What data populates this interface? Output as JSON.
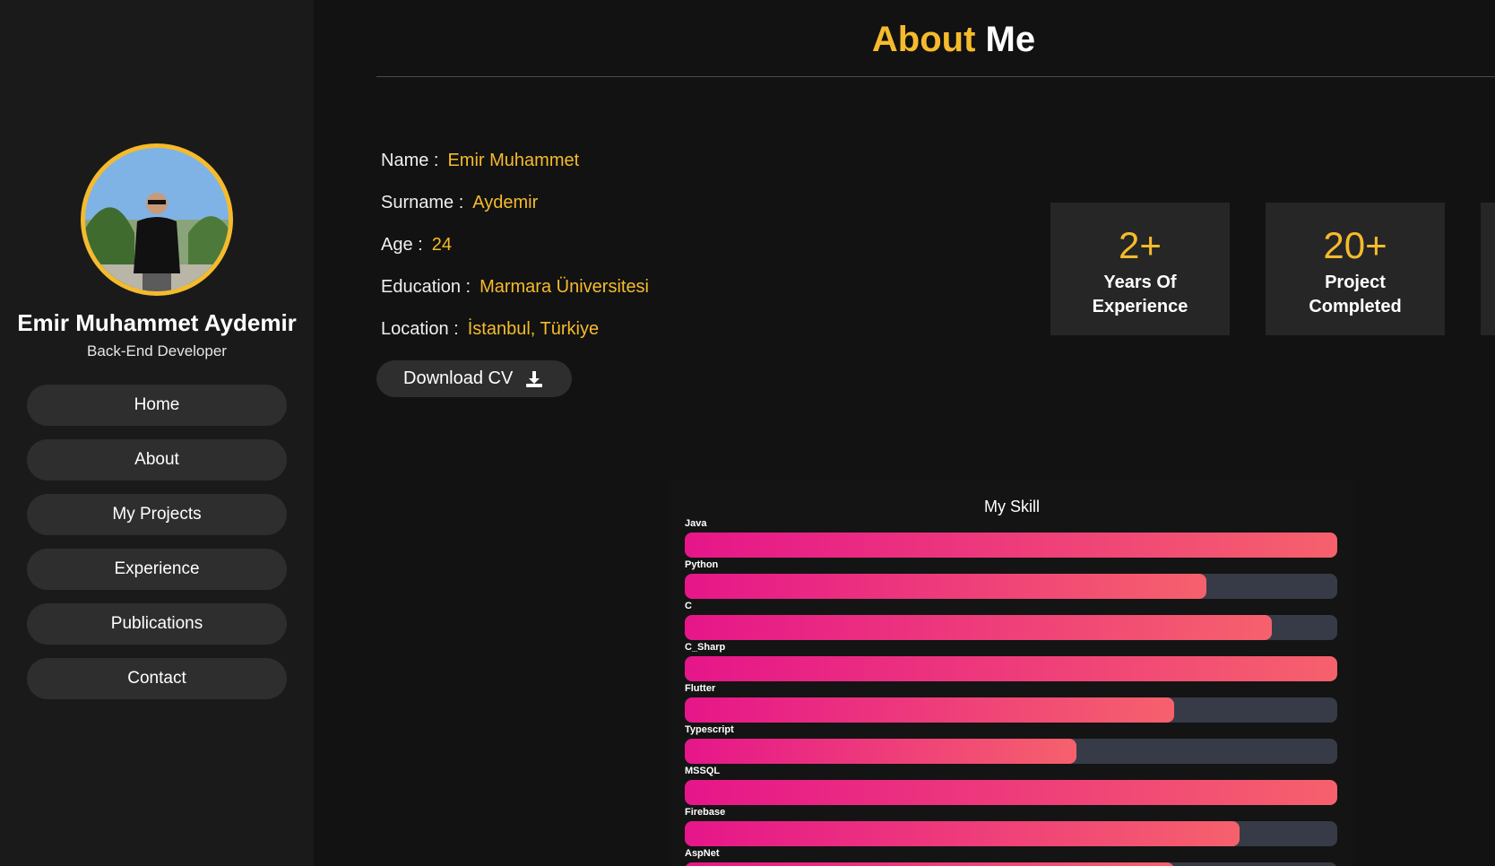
{
  "profile": {
    "name": "Emir Muhammet Aydemir",
    "role": "Back-End Developer"
  },
  "nav": [
    {
      "label": "Home"
    },
    {
      "label": "About"
    },
    {
      "label": "My Projects"
    },
    {
      "label": "Experience"
    },
    {
      "label": "Publications"
    },
    {
      "label": "Contact"
    }
  ],
  "page": {
    "title_accent": "About",
    "title_rest": "Me"
  },
  "info": {
    "name_label": "Name :",
    "name_value": "Emir Muhammet",
    "surname_label": "Surname :",
    "surname_value": "Aydemir",
    "age_label": "Age :",
    "age_value": "24",
    "education_label": "Education :",
    "education_value": "Marmara Üniversitesi",
    "location_label": "Location :",
    "location_value": "İstanbul, Türkiye"
  },
  "cv_button": {
    "label": "Download CV",
    "icon": "download-icon"
  },
  "stats": [
    {
      "number": "2+",
      "label_line1": "Years Of",
      "label_line2": "Experience"
    },
    {
      "number": "20+",
      "label_line1": "Project",
      "label_line2": "Completed"
    }
  ],
  "skills": {
    "title": "My Skill",
    "items": [
      {
        "name": "Java",
        "level": 1.0
      },
      {
        "name": "Python",
        "level": 0.8
      },
      {
        "name": "C",
        "level": 0.9
      },
      {
        "name": "C_Sharp",
        "level": 1.0
      },
      {
        "name": "Flutter",
        "level": 0.75
      },
      {
        "name": "Typescript",
        "level": 0.6
      },
      {
        "name": "MSSQL",
        "level": 1.0
      },
      {
        "name": "Firebase",
        "level": 0.85
      },
      {
        "name": "AspNet",
        "level": 0.75
      }
    ]
  },
  "colors": {
    "accent": "#f5bb2c",
    "background": "#121212",
    "sidebar": "#1a1a1a",
    "button": "#2e2e2e",
    "bar_start": "#e6168a",
    "bar_end": "#f6616c",
    "bar_track": "#373b47"
  }
}
